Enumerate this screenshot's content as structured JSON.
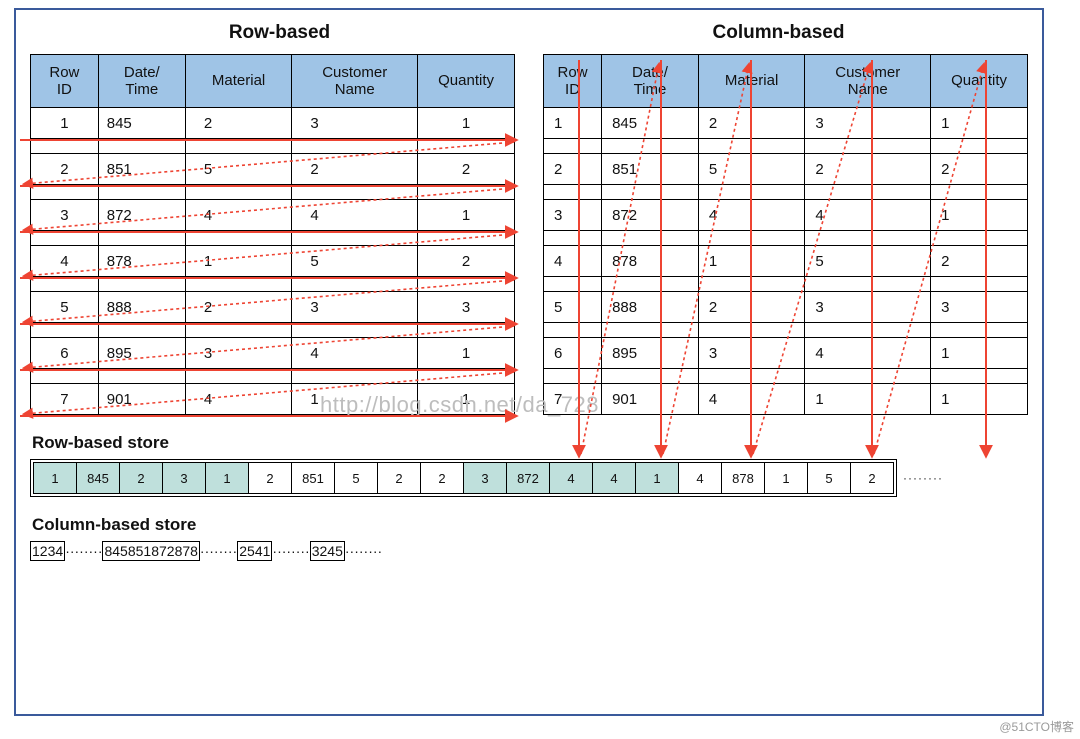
{
  "titles": {
    "row": "Row-based",
    "col": "Column-based"
  },
  "columns": [
    "Row\nID",
    "Date/\nTime",
    "Material",
    "Customer\nName",
    "Quantity"
  ],
  "rows": [
    {
      "id": "1",
      "dt": "845",
      "mat": "2",
      "cust": "3",
      "qty": "1"
    },
    {
      "id": "2",
      "dt": "851",
      "mat": "5",
      "cust": "2",
      "qty": "2"
    },
    {
      "id": "3",
      "dt": "872",
      "mat": "4",
      "cust": "4",
      "qty": "1"
    },
    {
      "id": "4",
      "dt": "878",
      "mat": "1",
      "cust": "5",
      "qty": "2"
    },
    {
      "id": "5",
      "dt": "888",
      "mat": "2",
      "cust": "3",
      "qty": "3"
    },
    {
      "id": "6",
      "dt": "895",
      "mat": "3",
      "cust": "4",
      "qty": "1"
    },
    {
      "id": "7",
      "dt": "901",
      "mat": "4",
      "cust": "1",
      "qty": "1"
    }
  ],
  "row_store": {
    "label": "Row-based store",
    "cells": [
      {
        "v": "1",
        "hl": true
      },
      {
        "v": "845",
        "hl": true
      },
      {
        "v": "2",
        "hl": true
      },
      {
        "v": "3",
        "hl": true
      },
      {
        "v": "1",
        "hl": true
      },
      {
        "v": "2"
      },
      {
        "v": "851"
      },
      {
        "v": "5"
      },
      {
        "v": "2"
      },
      {
        "v": "2"
      },
      {
        "v": "3",
        "hl": true
      },
      {
        "v": "872",
        "hl": true
      },
      {
        "v": "4",
        "hl": true
      },
      {
        "v": "4",
        "hl": true
      },
      {
        "v": "1",
        "hl": true
      },
      {
        "v": "4"
      },
      {
        "v": "878"
      },
      {
        "v": "1"
      },
      {
        "v": "5"
      },
      {
        "v": "2"
      }
    ],
    "trail": "········"
  },
  "col_store": {
    "label": "Column-based store",
    "groups": [
      {
        "hl": true,
        "cells": [
          "1",
          "2",
          "3",
          "4"
        ]
      },
      {
        "hl": false,
        "cells": [
          "845",
          "851",
          "872",
          "878"
        ]
      },
      {
        "hl": true,
        "cells": [
          "2",
          "5",
          "4",
          "1"
        ]
      },
      {
        "hl": false,
        "cells": [
          "3",
          "2",
          "4",
          "5"
        ]
      }
    ],
    "dots": "········"
  },
  "watermark": "@51CTO博客",
  "faint_url": "http://blog.csdn.net/da_728"
}
